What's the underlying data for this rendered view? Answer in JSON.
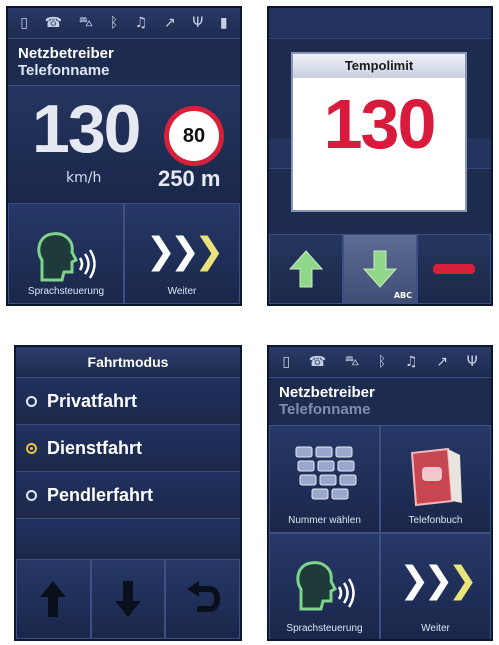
{
  "status_icons": [
    "phone-icon",
    "handset-icon",
    "car-icon",
    "bluetooth-icon",
    "music-icon",
    "signal-strength-icon",
    "antenna-icon",
    "battery-icon"
  ],
  "screen1": {
    "network": "Netzbetreiber",
    "phone_name": "Telefonname",
    "speed": "130",
    "speed_unit": "km/h",
    "speed_limit": "80",
    "distance": "250 m",
    "tiles": [
      {
        "label": "Sprachsteuerung"
      },
      {
        "label": "Weiter"
      }
    ]
  },
  "screen2": {
    "popup_title": "Tempolimit",
    "popup_value": "130",
    "abc_label": "ABC"
  },
  "screen3": {
    "title": "Fahrtmodus",
    "options": [
      {
        "label": "Privatfahrt",
        "selected": false
      },
      {
        "label": "Dienstfahrt",
        "selected": true
      },
      {
        "label": "Pendlerfahrt",
        "selected": false
      }
    ]
  },
  "screen4": {
    "network": "Netzbetreiber",
    "phone_name": "Telefonname",
    "tiles": [
      {
        "label": "Nummer wählen"
      },
      {
        "label": "Telefonbuch"
      },
      {
        "label": "Sprachsteuerung"
      },
      {
        "label": "Weiter"
      }
    ]
  },
  "colors": {
    "background": "#1d2b4f",
    "limit_red": "#d8203a",
    "popup_red": "#d81a3c",
    "voice_green": "#7fd38a",
    "chevron_yellow": "#e9e37a",
    "radio_selected": "#e9c244"
  }
}
